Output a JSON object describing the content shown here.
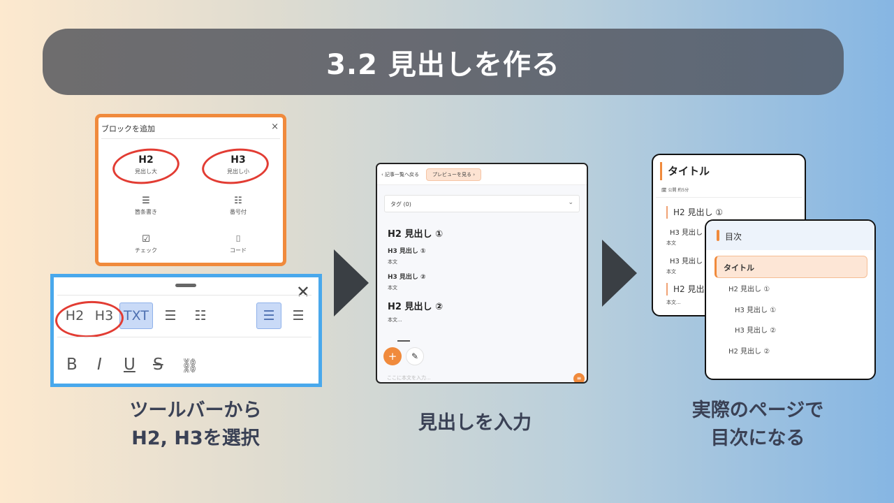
{
  "banner": {
    "title": "3.2 見出しを作る"
  },
  "block_panel": {
    "header": "ブロックを追加",
    "close": "×",
    "items": [
      {
        "label": "H2",
        "sub": "見出し大"
      },
      {
        "label": "H3",
        "sub": "見出し小"
      },
      {
        "icon": "☰",
        "sub": "箇条書き"
      },
      {
        "icon": "☷",
        "sub": "番号付"
      },
      {
        "icon": "☑",
        "sub": "チェック"
      },
      {
        "icon": "⌷",
        "sub": "コード"
      }
    ]
  },
  "toolbar": {
    "close": "✕",
    "h2": "H2",
    "h3": "H3",
    "txt": "TXT",
    "bullet_icon": "☰",
    "number_icon": "☷",
    "align_left_icon": "☰",
    "align_center_icon": "☰",
    "bold": "B",
    "italic": "I",
    "underline": "U",
    "strike": "S",
    "link_icon": "⛓"
  },
  "captions": {
    "left": [
      "ツールバーから",
      "H2, H3を選択"
    ],
    "middle": "見出しを入力",
    "right": [
      "実際のページで",
      "目次になる"
    ]
  },
  "editor": {
    "back": "‹ 記事一覧へ戻る",
    "preview": "プレビューを見る ›",
    "tag": "タグ (0)",
    "tag_chevron": "⌄",
    "h2_1": "H2 見出し ①",
    "h3_1": "H3 見出し ①",
    "body_1": "本文",
    "h3_2": "H3 見出し ②",
    "body_2": "本文",
    "h2_2": "H2 見出し ②",
    "body_3": "本文...",
    "plus": "+",
    "pen": "✎",
    "placeholder": "ここに本文を入力...",
    "menu": "≡"
  },
  "page_card": {
    "title": "タイトル",
    "meta": "🗓 公開 約5分",
    "h2_1": "H2 見出し ①",
    "h3_1": "H3 見出し",
    "body_1": "本文",
    "h3_2": "H3 見出し",
    "body_2": "本文",
    "h2_2": "H2 見出",
    "body_3": "本文..."
  },
  "toc_card": {
    "title": "目次",
    "active": "タイトル",
    "items": [
      "H2 見出し ①",
      "H3 見出し ①",
      "H3 見出し ②",
      "H2 見出し ②"
    ]
  },
  "colors": {
    "accent_orange": "#f08a3c",
    "accent_blue": "#49a8ec",
    "circle_red": "#e23c33"
  }
}
